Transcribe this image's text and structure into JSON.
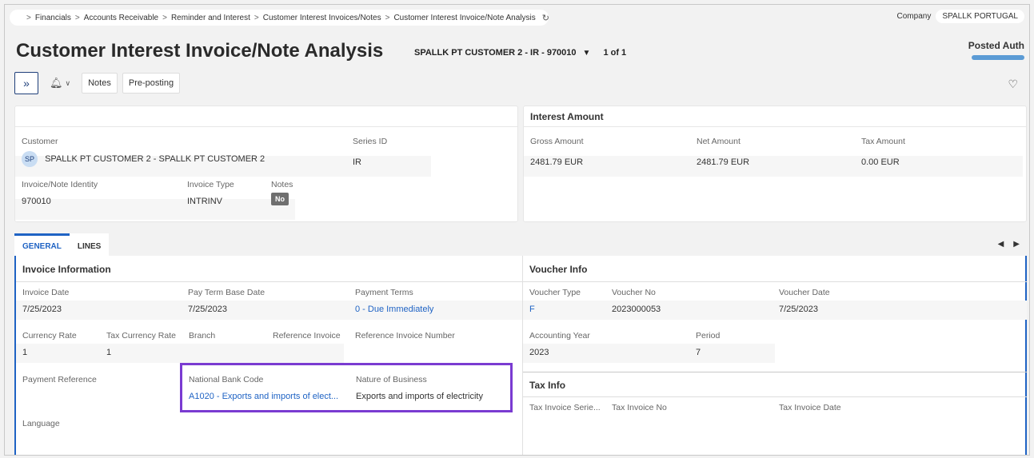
{
  "breadcrumb": [
    "Financials",
    "Accounts Receivable",
    "Reminder and Interest",
    "Customer Interest Invoices/Notes",
    "Customer Interest Invoice/Note Analysis"
  ],
  "company": {
    "label": "Company",
    "value": "SPALLK PORTUGAL"
  },
  "title": "Customer Interest Invoice/Note Analysis",
  "record": {
    "id": "SPALLK PT CUSTOMER 2 - IR - 970010",
    "count": "1 of 1"
  },
  "status": {
    "label": "Posted Auth",
    "progress": 1.0
  },
  "toolbar": {
    "notes": "Notes",
    "preposting": "Pre-posting"
  },
  "header_card": {
    "customer_label": "Customer",
    "customer_avatar": "SP",
    "customer_value": "SPALLK PT CUSTOMER 2 - SPALLK PT CUSTOMER 2",
    "series_label": "Series ID",
    "series_value": "IR",
    "identity_label": "Invoice/Note Identity",
    "identity_value": "970010",
    "type_label": "Invoice Type",
    "type_value": "INTRINV",
    "notes_label": "Notes",
    "notes_value": "No"
  },
  "interest": {
    "title": "Interest Amount",
    "gross_label": "Gross Amount",
    "gross_value": "2481.79 EUR",
    "net_label": "Net Amount",
    "net_value": "2481.79 EUR",
    "tax_label": "Tax Amount",
    "tax_value": "0.00 EUR"
  },
  "tabs": {
    "general": "GENERAL",
    "lines": "LINES"
  },
  "invoice_info": {
    "title": "Invoice Information",
    "invoice_date_label": "Invoice Date",
    "invoice_date": "7/25/2023",
    "pay_term_label": "Pay Term Base Date",
    "pay_term": "7/25/2023",
    "payment_terms_label": "Payment Terms",
    "payment_terms": "0 - Due Immediately",
    "currency_rate_label": "Currency Rate",
    "currency_rate": "1",
    "tax_currency_rate_label": "Tax Currency Rate",
    "tax_currency_rate": "1",
    "branch_label": "Branch",
    "reference_invoice_label": "Reference Invoice",
    "reference_invoice_number_label": "Reference Invoice Number",
    "payment_reference_label": "Payment Reference",
    "national_bank_code_label": "National Bank Code",
    "national_bank_code": "A1020 - Exports and imports of elect...",
    "nature_of_business_label": "Nature of Business",
    "nature_of_business": "Exports and imports of electricity",
    "language_label": "Language"
  },
  "voucher_info": {
    "title": "Voucher Info",
    "type_label": "Voucher Type",
    "type": "F",
    "no_label": "Voucher No",
    "no": "2023000053",
    "date_label": "Voucher Date",
    "date": "7/25/2023",
    "year_label": "Accounting Year",
    "year": "2023",
    "period_label": "Period",
    "period": "7"
  },
  "tax_info": {
    "title": "Tax Info",
    "series_label": "Tax Invoice Serie...",
    "no_label": "Tax Invoice No",
    "date_label": "Tax Invoice Date"
  }
}
